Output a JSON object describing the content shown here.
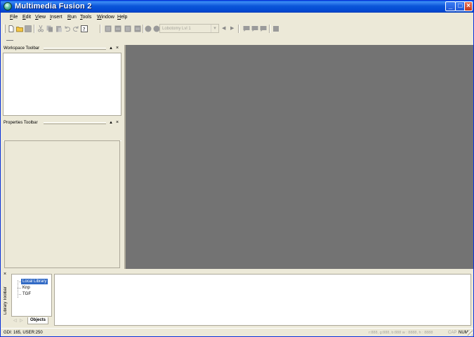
{
  "window": {
    "title": "Multimedia Fusion 2",
    "controls": {
      "minimize": "_",
      "maximize": "□",
      "close": "×"
    }
  },
  "menu": [
    {
      "label": "File",
      "key": "F"
    },
    {
      "label": "Edit",
      "key": "E"
    },
    {
      "label": "View",
      "key": "V"
    },
    {
      "label": "Insert",
      "key": "I"
    },
    {
      "label": "Run",
      "key": "R"
    },
    {
      "label": "Tools",
      "key": "T"
    },
    {
      "label": "Window",
      "key": "W"
    },
    {
      "label": "Help",
      "key": "H"
    }
  ],
  "toolbar": {
    "frame_select": {
      "value": "Lobotomy Lvl 1",
      "arrow": "▾"
    },
    "prev_arrow": "◀",
    "next_arrow": "▶"
  },
  "panels": {
    "workspace": {
      "title": "Workspace Toolbar",
      "pin": "▴",
      "close": "×"
    },
    "properties": {
      "title": "Properties Toolbar",
      "pin": "▴",
      "close": "×"
    }
  },
  "library": {
    "title": "Library Toolbar",
    "close": "×",
    "pin": "▾",
    "tree": [
      {
        "label": "Local Library",
        "selected": true
      },
      {
        "label": "Knp",
        "selected": false
      },
      {
        "label": "TGF",
        "selected": false
      }
    ],
    "tabs": {
      "prev": "◁",
      "next": "▷",
      "active": "Objects"
    }
  },
  "status": {
    "gdi": "GDI: 165, USER:250",
    "coords": "r:888, g:888, b:888  w : 8888, h : 8888",
    "cap": "CAP",
    "num": "NUM"
  },
  "colors": {
    "titlebar": "#0a55d9",
    "workspace_bg": "#737373",
    "chrome": "#ece9d8",
    "selection": "#316ac5"
  }
}
